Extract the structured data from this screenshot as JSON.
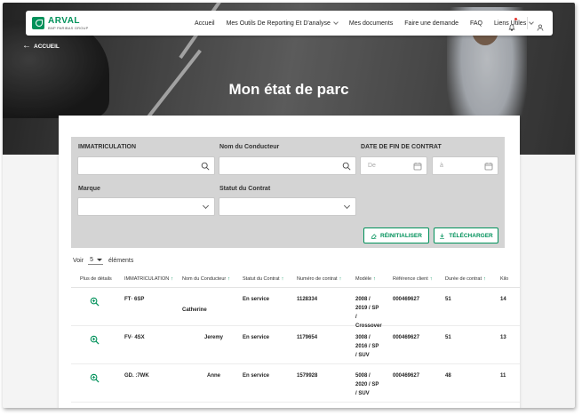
{
  "brand": {
    "name": "ARVAL",
    "tagline": "BNP PARIBAS GROUP",
    "color": "#00915a"
  },
  "nav": {
    "items": [
      {
        "label": "Accueil"
      },
      {
        "label": "Mes Outils De Reporting Et D'analyse",
        "dropdown": true
      },
      {
        "label": "Mes documents"
      },
      {
        "label": "Faire une demande"
      },
      {
        "label": "FAQ"
      },
      {
        "label": "Liens Utiles",
        "dropdown": true
      }
    ],
    "icons": [
      "bell-icon",
      "user-icon"
    ]
  },
  "back_label": "ACCUEIL",
  "page_title": "Mon état de parc",
  "filters": {
    "immatriculation_label": "IMMATRICULATION",
    "conducteur_label": "Nom du Conducteur",
    "date_fin_label": "DATE DE FIN DE CONTRAT",
    "date_from_placeholder": "De",
    "date_to_placeholder": "à",
    "marque_label": "Marque",
    "statut_label": "Statut du Contrat"
  },
  "buttons": {
    "reset": "RÉINITIALISER",
    "download": "TÉLÉCHARGER"
  },
  "pager": {
    "prefix": "Voir",
    "value": "5",
    "suffix": "éléments"
  },
  "table": {
    "headers": [
      {
        "label": "Plus de détails",
        "sortable": false
      },
      {
        "label": "IMMATRICULATION",
        "sortable": true
      },
      {
        "label": "Nom du Conducteur",
        "sortable": true
      },
      {
        "label": "Statut du Contrat",
        "sortable": true
      },
      {
        "label": "Numéro de contrat",
        "sortable": true
      },
      {
        "label": "Modèle",
        "sortable": true
      },
      {
        "label": "Référence client",
        "sortable": true
      },
      {
        "label": "Durée de contrat",
        "sortable": true
      },
      {
        "label": "Kilo",
        "sortable": false
      }
    ],
    "rows": [
      {
        "immat": "FT·  6SP",
        "driver": "Catherine",
        "statut": "En service",
        "contrat": "1128334",
        "modele": [
          "2008 /",
          "2019 / SP",
          "/",
          "Crossover"
        ],
        "ref": "000469627",
        "duree": "51",
        "kilo": "14"
      },
      {
        "immat": "FV·  4SX",
        "driver": "Jeremy",
        "statut": "En service",
        "contrat": "1179654",
        "modele": [
          "3008 /",
          "2016 / SP",
          "/ SUV"
        ],
        "ref": "000469627",
        "duree": "51",
        "kilo": "13"
      },
      {
        "immat": "GD.  :7WK",
        "driver": "Anne",
        "statut": "En service",
        "contrat": "1579928",
        "modele": [
          "5008 /",
          "2020 / SP",
          "/ SUV"
        ],
        "ref": "000469627",
        "duree": "48",
        "kilo": "11"
      }
    ]
  }
}
